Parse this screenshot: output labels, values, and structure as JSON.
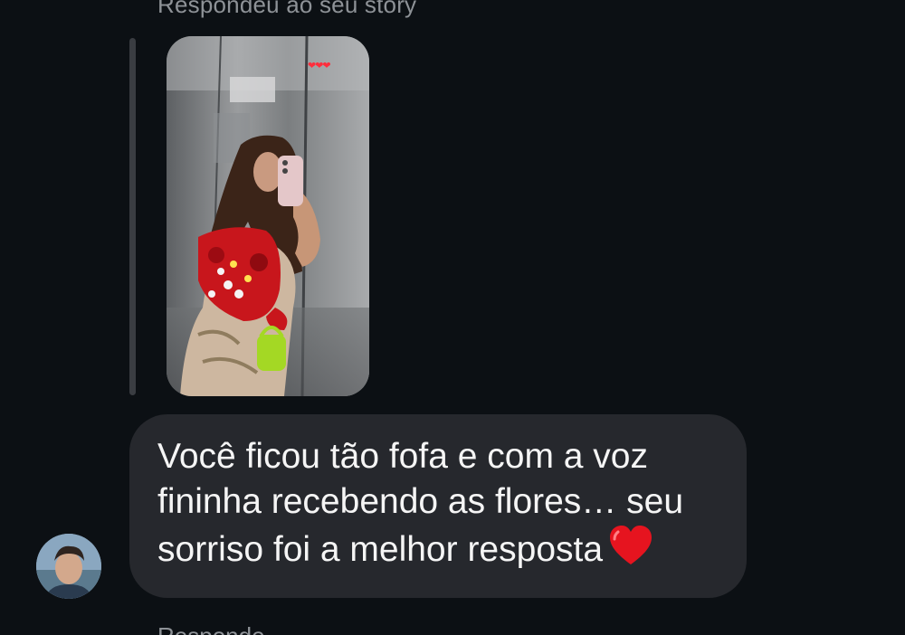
{
  "reply_context": {
    "label": "Respondeu ao seu story",
    "story_hearts": "❤❤❤"
  },
  "message": {
    "lines": [
      "Você ficou tão fofa e com a voz",
      "fininha recebendo as flores… seu",
      "sorriso foi a melhor resposta"
    ],
    "emoji": "red-heart-emoji"
  },
  "sender": {
    "avatar": "user-avatar-photo"
  },
  "next_item": {
    "label": "Respondeu"
  },
  "colors": {
    "background": "#0c1014",
    "bubble": "#26282d",
    "message_text": "#f5f5f5",
    "secondary_text": "#8e9297",
    "heart": "#e6141f"
  }
}
